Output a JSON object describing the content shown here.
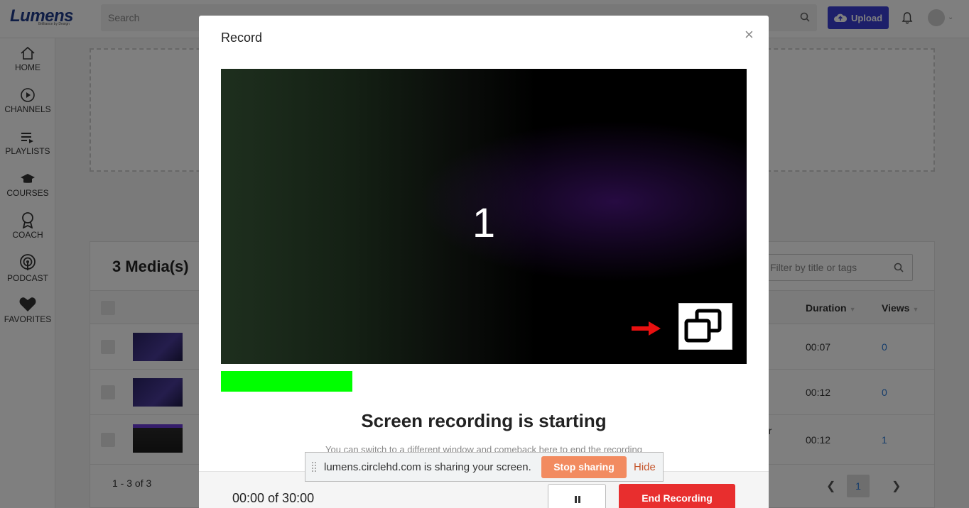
{
  "header": {
    "logo_text": "Lumens",
    "logo_tagline": "Brilliance by Design",
    "search_placeholder": "Search",
    "upload_label": "Upload"
  },
  "sidebar": {
    "items": [
      {
        "label": "HOME",
        "icon": "home-icon"
      },
      {
        "label": "CHANNELS",
        "icon": "play-circle-icon"
      },
      {
        "label": "PLAYLISTS",
        "icon": "playlist-icon"
      },
      {
        "label": "COURSES",
        "icon": "graduation-cap-icon"
      },
      {
        "label": "COACH",
        "icon": "coach-icon"
      },
      {
        "label": "PODCAST",
        "icon": "podcast-icon"
      },
      {
        "label": "FAVORITES",
        "icon": "heart-icon"
      }
    ]
  },
  "media": {
    "title": "3 Media(s)",
    "filter_placeholder": "Filter by title or tags",
    "columns": {
      "duration": "Duration",
      "views": "Views"
    },
    "rows": [
      {
        "title_fragment": "",
        "duration": "00:07",
        "views": "0"
      },
      {
        "title_fragment": "",
        "duration": "00:12",
        "views": "0"
      },
      {
        "title_fragment": "er",
        "duration": "00:12",
        "views": "1"
      }
    ],
    "pager_info": "1 - 3 of 3",
    "current_page": "1"
  },
  "modal": {
    "title": "Record",
    "close_label": "×",
    "countdown": "1",
    "status": "Screen recording is starting",
    "hint": "You can switch to a different window and comeback here to end the recording",
    "timer": "00:00 of 30:00",
    "end_label": "End Recording",
    "audio_level": 0.25
  },
  "share_bar": {
    "message": "lumens.circlehd.com is sharing your screen.",
    "stop_label": "Stop sharing",
    "hide_label": "Hide"
  },
  "colors": {
    "brand": "#1e3a8a",
    "upload": "#3a3fd4",
    "end_recording": "#e82e2e",
    "stop_sharing": "#f28b60",
    "meter": "#00ff00",
    "link": "#2878d6"
  }
}
